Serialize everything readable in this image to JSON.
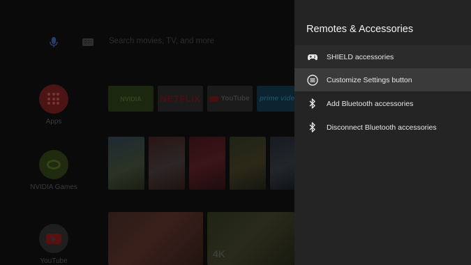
{
  "search": {
    "placeholder": "Search movies, TV, and more"
  },
  "side_apps": [
    {
      "label": "Apps"
    },
    {
      "label": "NVIDIA Games"
    },
    {
      "label": "YouTube"
    }
  ],
  "tiles": {
    "nvidia": "NVIDIA",
    "netflix": "NETFLIX",
    "youtube": "YouTube",
    "prime": "prime vide"
  },
  "wide": {
    "k4": "4K"
  },
  "panel": {
    "title": "Remotes & Accessories",
    "items": [
      {
        "label": "SHIELD accessories",
        "icon": "gamepad-icon"
      },
      {
        "label": "Customize Settings button",
        "icon": "settings-button-icon",
        "focused": true
      },
      {
        "label": "Add Bluetooth accessories",
        "icon": "bluetooth-icon"
      },
      {
        "label": "Disconnect Bluetooth accessories",
        "icon": "bluetooth-icon"
      }
    ]
  },
  "colors": {
    "panel_bg": "#242424",
    "focus_bg": "#3a3a3a",
    "text": "#e8e8e8"
  }
}
